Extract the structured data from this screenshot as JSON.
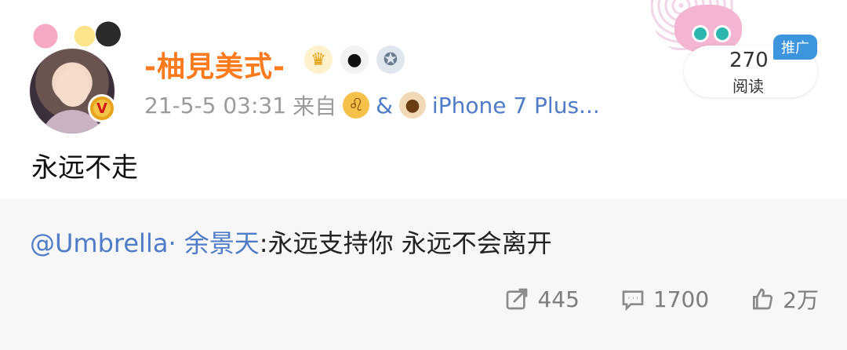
{
  "post": {
    "username": "-柚見美式-",
    "timestamp": "21-5-5 03:31",
    "source_prefix": "来自",
    "source_join": "&",
    "source_device": "iPhone 7 Plus...",
    "content": "永远不走",
    "read_count": "270",
    "read_label": "阅读",
    "promo_tag": "推广"
  },
  "reply": {
    "mention": "@Umbrella· 余景天",
    "text": ":永远支持你 永远不会离开"
  },
  "actions": {
    "repost_count": "445",
    "comment_count": "1700",
    "like_count": "2万"
  },
  "icons": {
    "verified": "verified-v-icon",
    "crown": "crown-badge-icon",
    "panda": "panda-badge-icon",
    "medal": "medal-badge-icon",
    "lion": "lion-emoji-icon",
    "dog": "dog-emoji-icon",
    "repost": "repost-icon",
    "comment": "comment-icon",
    "like": "thumbs-up-icon"
  },
  "colors": {
    "username": "#ff7a1c",
    "link": "#4f7cc7",
    "meta": "#9b9b9b",
    "promo": "#3d95de",
    "reply_bg": "#f7f7f7"
  }
}
